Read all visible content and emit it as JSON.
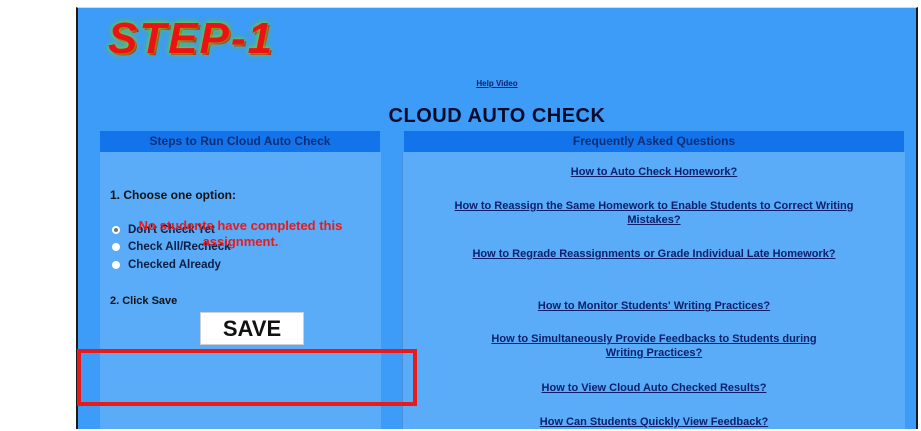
{
  "step_title": "STEP-1",
  "help_link": "Help Video",
  "main_title": "CLOUD AUTO CHECK",
  "left_header": "Steps to Run Cloud Auto Check",
  "right_header": "Frequently Asked Questions",
  "step1_label": "1. Choose one option:",
  "options": [
    {
      "label": "Don't Check Yet",
      "checked": true
    },
    {
      "label": "Check All/Recheck",
      "checked": false
    },
    {
      "label": "Checked Already",
      "checked": false
    }
  ],
  "step2_label": "2. Click Save",
  "save_label": "SAVE",
  "notice": "No students have completed this assignment.",
  "faqs": [
    "How to Auto Check Homework?",
    "How to Reassign the Same Homework to Enable Students to Correct Writing Mistakes?",
    "How to Regrade Reassignments or Grade Individual Late Homework?",
    "How to Monitor Students' Writing Practices?",
    "How to Simultaneously Provide Feedbacks to Students during Writing Practices?",
    "How to View Cloud Auto Checked Results?",
    "How Can Students Quickly View Feedback?"
  ],
  "colors": {
    "page_bg": "#3d9cf7",
    "header_bg": "#1273ea",
    "title_red": "#ee1111",
    "notice_red": "#e81a1a",
    "link": "#0c1f6a"
  }
}
